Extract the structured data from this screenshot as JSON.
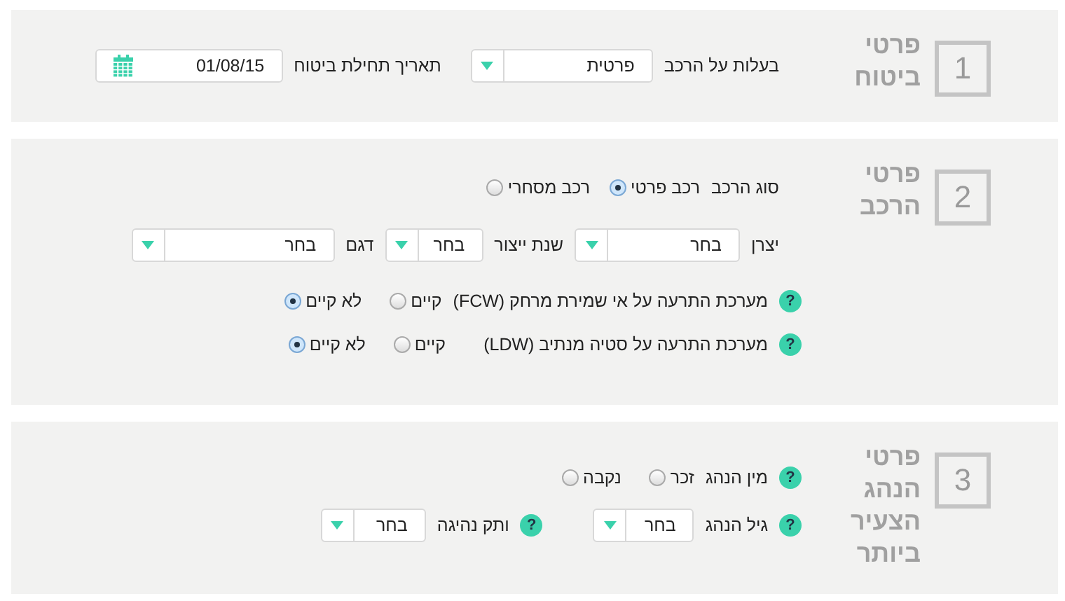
{
  "sections": [
    {
      "number": "1",
      "title": "פרטי ביטוח",
      "rows": [
        {
          "items": [
            {
              "kind": "label",
              "text": "בעלות על הרכב"
            },
            {
              "kind": "select",
              "value": "פרטית"
            },
            {
              "kind": "label",
              "text": "תאריך תחילת ביטוח"
            },
            {
              "kind": "date",
              "value": "01/08/15"
            }
          ]
        }
      ]
    },
    {
      "number": "2",
      "title": "פרטי הרכב",
      "rows": [
        {
          "items": [
            {
              "kind": "label",
              "text": "סוג הרכב"
            },
            {
              "kind": "radio",
              "text": "רכב פרטי",
              "selected": true
            },
            {
              "kind": "radio",
              "text": "רכב מסחרי",
              "selected": false
            }
          ]
        },
        {
          "items": [
            {
              "kind": "label",
              "text": "יצרן"
            },
            {
              "kind": "select",
              "value": "בחר"
            },
            {
              "kind": "label",
              "text": "שנת ייצור"
            },
            {
              "kind": "select",
              "value": "בחר"
            },
            {
              "kind": "label",
              "text": "דגם"
            },
            {
              "kind": "select",
              "value": "בחר"
            }
          ]
        },
        {
          "items": [
            {
              "kind": "help",
              "text": "?"
            },
            {
              "kind": "label",
              "text": "מערכת התרעה על אי שמירת מרחק (FCW)"
            },
            {
              "kind": "radio",
              "text": "קיים",
              "selected": false
            },
            {
              "kind": "radio",
              "text": "לא קיים",
              "selected": true
            }
          ]
        },
        {
          "items": [
            {
              "kind": "help",
              "text": "?"
            },
            {
              "kind": "label",
              "text": "מערכת התרעה על סטיה מנתיב (LDW)"
            },
            {
              "kind": "radio",
              "text": "קיים",
              "selected": false
            },
            {
              "kind": "radio",
              "text": "לא קיים",
              "selected": true
            }
          ]
        }
      ]
    },
    {
      "number": "3",
      "title": "פרטי הנהג הצעיר ביותר",
      "rows": [
        {
          "items": [
            {
              "kind": "help",
              "text": "?"
            },
            {
              "kind": "label",
              "text": "מין הנהג"
            },
            {
              "kind": "radio",
              "text": "זכר",
              "selected": false
            },
            {
              "kind": "radio",
              "text": "נקבה",
              "selected": false
            }
          ]
        },
        {
          "items": [
            {
              "kind": "help",
              "text": "?"
            },
            {
              "kind": "label",
              "text": "גיל הנהג"
            },
            {
              "kind": "select",
              "value": "בחר"
            },
            {
              "kind": "help",
              "text": "?"
            },
            {
              "kind": "label",
              "text": "ותק נהיגה"
            },
            {
              "kind": "select",
              "value": "בחר"
            }
          ]
        }
      ]
    }
  ]
}
